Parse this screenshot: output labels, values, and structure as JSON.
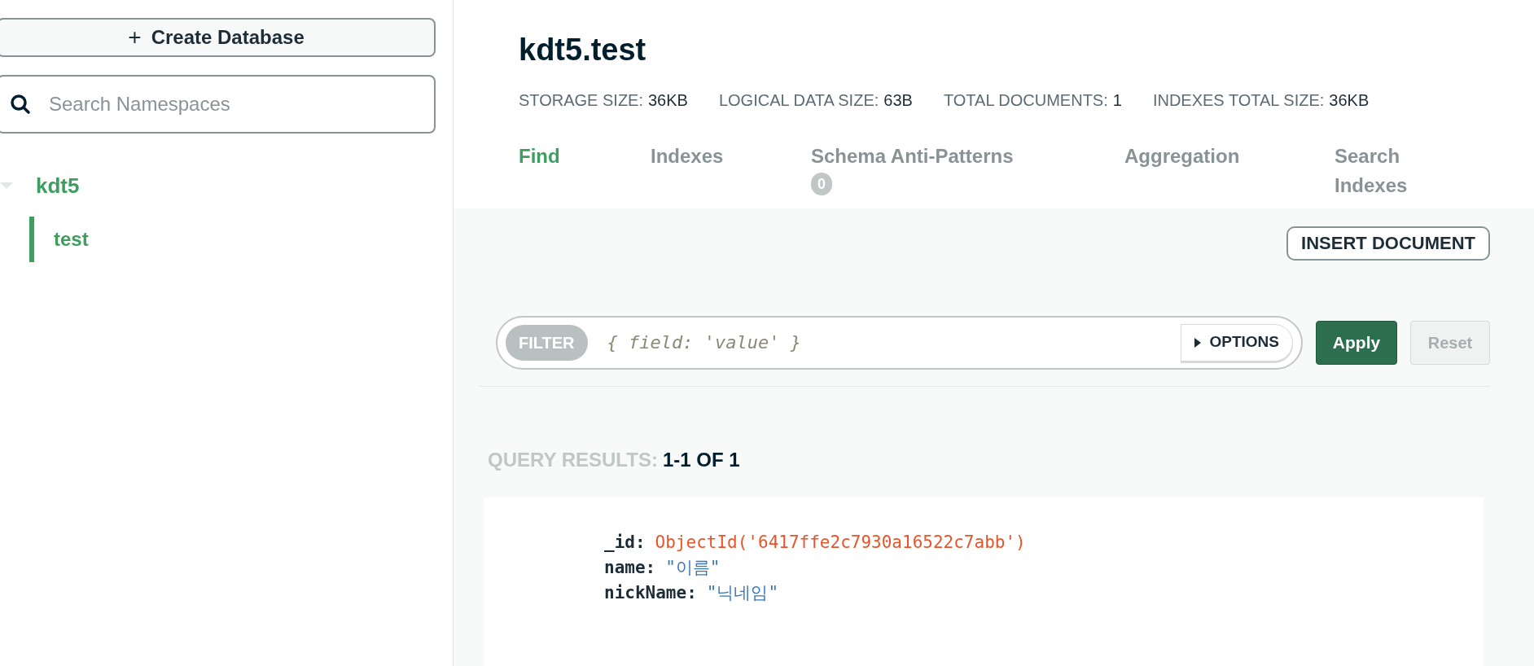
{
  "sidebar": {
    "create_button": {
      "icon": "+",
      "label": "Create Database"
    },
    "search": {
      "placeholder": "Search Namespaces"
    },
    "tree": [
      {
        "label": "kdt5",
        "expanded": true,
        "children": [
          {
            "label": "test",
            "selected": true
          }
        ]
      }
    ]
  },
  "header": {
    "title": "kdt5.test",
    "stats": [
      {
        "label": "STORAGE SIZE:",
        "value": "36KB"
      },
      {
        "label": "LOGICAL DATA SIZE:",
        "value": "63B"
      },
      {
        "label": "TOTAL DOCUMENTS:",
        "value": "1"
      },
      {
        "label": "INDEXES TOTAL SIZE:",
        "value": "36KB"
      }
    ],
    "tabs": [
      {
        "label": "Find",
        "selected": true
      },
      {
        "label": "Indexes",
        "selected": false
      },
      {
        "label": "Schema Anti-Patterns",
        "selected": false,
        "badge": "0"
      },
      {
        "label": "Aggregation",
        "selected": false
      },
      {
        "label": "Search Indexes",
        "selected": false
      }
    ]
  },
  "toolbar": {
    "insert_button": "INSERT DOCUMENT"
  },
  "filter": {
    "label": "FILTER",
    "placeholder": "{ field: 'value' }",
    "options_button": "OPTIONS",
    "expanded": false,
    "apply_button": "Apply",
    "reset_button": "Reset",
    "reset_disabled": true
  },
  "results": {
    "label": "QUERY RESULTS:",
    "range": "1-1 OF 1"
  },
  "document": {
    "fields": [
      {
        "key": "_id:",
        "kind": "objectid",
        "value": "ObjectId('6417ffe2c7930a16522c7abb')"
      },
      {
        "key": "name:",
        "kind": "string",
        "value": "\"이름\""
      },
      {
        "key": "nickName:",
        "kind": "string",
        "value": "\"닉네임\""
      }
    ]
  }
}
